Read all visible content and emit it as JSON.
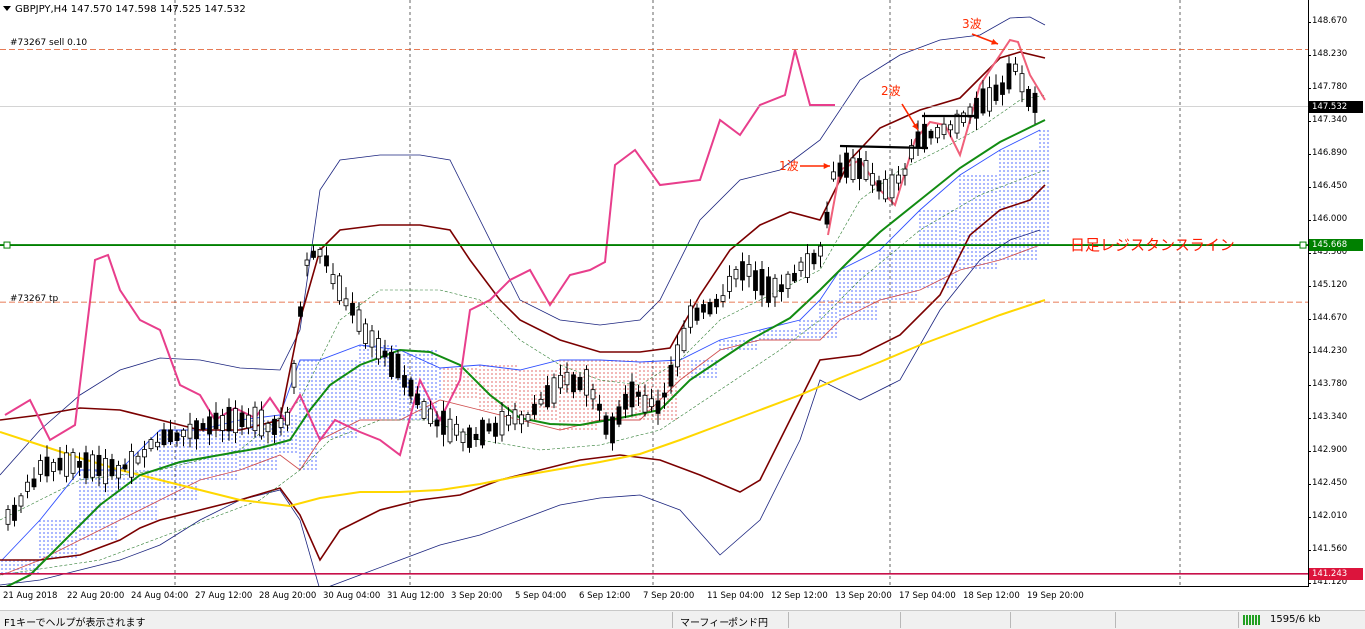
{
  "chart_header": {
    "symbol_timeframe": "GBPJPY,H4",
    "ohlc": "147.570 147.598 147.525 147.532"
  },
  "order_labels": {
    "sell": "#73267 sell 0.10",
    "tp": "#73267 tp"
  },
  "annotations": {
    "wave1": "1波",
    "wave2": "2波",
    "wave3": "3波",
    "resistance": "日足レジスタンスライン"
  },
  "price_axis": {
    "ticks": [
      "148.670",
      "148.230",
      "147.780",
      "147.340",
      "146.890",
      "146.450",
      "146.000",
      "145.560",
      "145.120",
      "144.670",
      "144.230",
      "143.780",
      "143.340",
      "142.900",
      "142.450",
      "142.010",
      "141.560",
      "141.120"
    ],
    "current_price": "147.532",
    "resistance_price": "145.668",
    "low_line_price": "141.243",
    "colors": {
      "current": "#000000",
      "resistance": "#008000",
      "low_line": "#dc143c"
    }
  },
  "time_axis": {
    "labels": [
      "21 Aug 2018",
      "22 Aug 20:00",
      "24 Aug 04:00",
      "27 Aug 12:00",
      "28 Aug 20:00",
      "30 Aug 04:00",
      "31 Aug 12:00",
      "3 Sep 20:00",
      "5 Sep 04:00",
      "6 Sep 12:00",
      "7 Sep 20:00",
      "11 Sep 04:00",
      "12 Sep 12:00",
      "13 Sep 20:00",
      "17 Sep 04:00",
      "18 Sep 12:00",
      "19 Sep 20:00"
    ]
  },
  "statusbar": {
    "help": "F1キーでヘルプが表示されます",
    "profile": "マーフィー",
    "symbol": "ポンド円",
    "traffic": "1595/6 kb"
  }
}
